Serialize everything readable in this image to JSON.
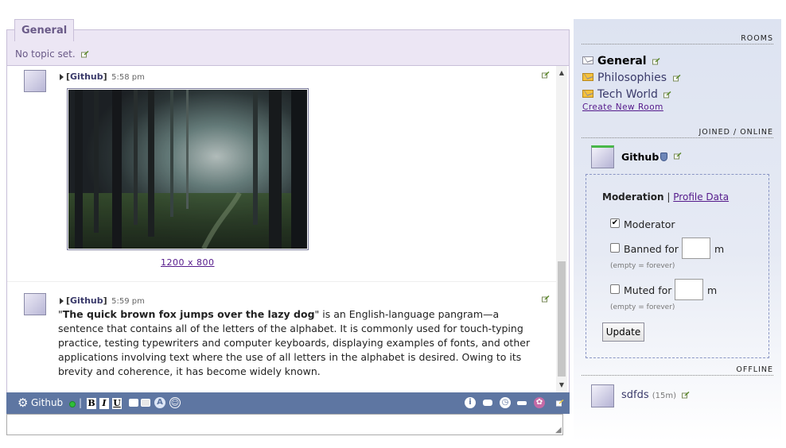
{
  "room": {
    "tab_label": "General",
    "topic": "No topic set."
  },
  "messages": [
    {
      "user": "Github",
      "time": "5:58 pm",
      "image_caption": "1200 x 800"
    },
    {
      "user": "Github",
      "time": "5:59 pm",
      "body_open_quote": "\"",
      "body_bold": "The quick brown fox jumps over the lazy dog",
      "body_rest": "\" is an English-language pangram—a sentence that contains all of the letters of the alphabet. It is commonly used for touch-typing practice, testing typewriters and computer keyboards, displaying examples of fonts, and other applications involving text where the use of all letters in the alphabet is desired. Owing to its brevity and coherence, it has become widely known."
    }
  ],
  "toolbar": {
    "user": "Github",
    "separator": "|",
    "bold": "B",
    "italic": "I",
    "underline": "U",
    "info": "i"
  },
  "sidebar": {
    "rooms_heading": "ROOMS",
    "rooms": [
      {
        "name": "General",
        "icon": "envelope-icon"
      },
      {
        "name": "Philosophies",
        "icon": "envelope-unread-icon"
      },
      {
        "name": "Tech World",
        "icon": "envelope-unread-icon"
      }
    ],
    "create_room": "Create New Room",
    "joined_heading": "JOINED / ONLINE",
    "joined_user": "Github",
    "moderation": {
      "title": "Moderation",
      "separator": "|",
      "profile_link": "Profile Data",
      "moderator_label": "Moderator",
      "moderator_checked": true,
      "banned_label": "Banned for",
      "banned_unit": "m",
      "banned_hint": "(empty = forever)",
      "muted_label": "Muted for",
      "muted_unit": "m",
      "muted_hint": "(empty = forever)",
      "update_label": "Update"
    },
    "offline_heading": "OFFLINE",
    "offline_user": "sdfds",
    "offline_idle": "(15m)"
  },
  "colors": {
    "accent": "#5e76a2",
    "room_tab": "#ece6f4",
    "online": "#2fbf3a"
  }
}
